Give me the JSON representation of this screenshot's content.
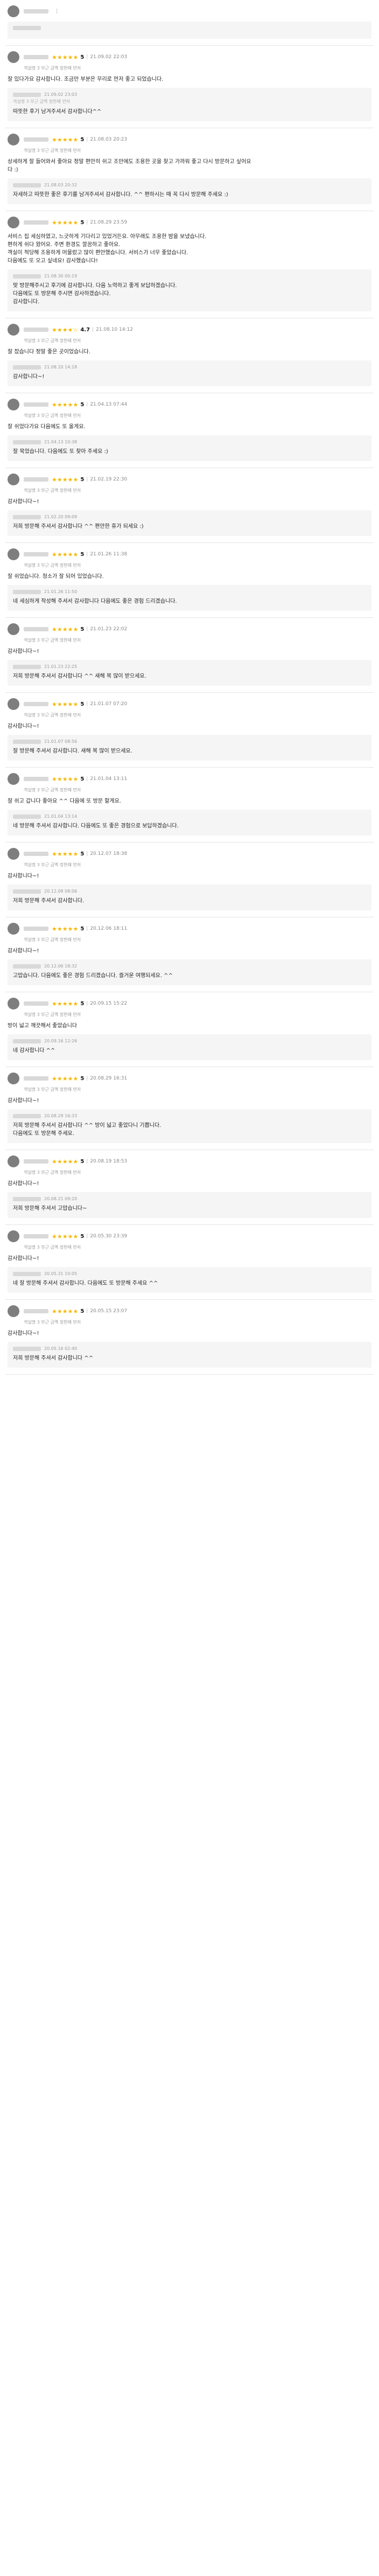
{
  "reviews": [
    {
      "stars": "",
      "score": "",
      "date": "",
      "meta": "",
      "text": "",
      "reply": {
        "date": "",
        "meta": "",
        "text": ""
      }
    },
    {
      "stars": "★★★★★",
      "score": "5",
      "date": "21.09.02 22:03",
      "meta": "객실명  3 부근 금액 정한때 먼저",
      "text": "잘 있다가요 감사합니다. 조금만 부분은 무리로 먼저 좋고 되었습니다.",
      "reply": {
        "date": "21.09.02 23:03",
        "meta": "객실명  3 부근 금액 정한때 먼저",
        "text": "따뜻한 후기 남겨주셔서 감사합니다^^"
      }
    },
    {
      "stars": "★★★★★",
      "score": "5",
      "date": "21.08.03 20:23",
      "meta": "객실명  3 부근 금액 정한때 먼저",
      "text": "상세하게 잘 들어와서 좋아요 정말 편안히 쉬고 조만에도 조용한 곳을 찾고 가까워 좋고 다시 방문하고 싶어요\n다 :)",
      "reply": {
        "date": "21.08.03 20:32",
        "meta": "",
        "text": "자세하고 따뜻한 좋은 후기를 남겨주셔서 감사합니다. ^^ 편하시는 때 꼭 다시 방문해 주세요 :)"
      }
    },
    {
      "stars": "★★★★★",
      "score": "5",
      "date": "21.08.29 23:59",
      "meta": "",
      "text": "서비스 집 세심하였고, 느긋하게 기다리고 있었거든요. 아무래도 조용한 밤을 보냈습니다.\n편하게 쉬다 왔어요. 주변 환경도 깔끔하고 좋아요.\n객실이 적당해 조용하게 머물렀고 많이 편안했습니다. 서비스가 너무 좋았습니다.\n다음에도 또 오고 싶네요! 감사했습니다!",
      "reply": {
        "date": "21.08.30 00:19",
        "meta": "",
        "text": "맞 방문해주시고 후기에 감사합니다. 다음 노력하고 좋게 보답하겠습니다.\n다음에도 또 방문해 주시면 감사하겠습니다.\n감사합니다."
      }
    },
    {
      "stars": "★★★★☆",
      "score": "4.7",
      "date": "21.08.10 14:12",
      "meta": "객실명  3 부근 금액 정한때 먼저",
      "text": "잘 잤습니다 정말 좋은 곳이었습니다.",
      "reply": {
        "date": "21.08.10 14:18",
        "meta": "",
        "text": "감사합니다~!"
      }
    },
    {
      "stars": "★★★★★",
      "score": "5",
      "date": "21.04.13 07:44",
      "meta": "객실명  3 부근 금액 정한때 먼저",
      "text": "잘 쉬었다가요 다음에도 또 올게요.",
      "reply": {
        "date": "21.04.13 10:38",
        "meta": "",
        "text": "잘 묵었습니다. 다음에도 또 찾아 주세요 :)"
      }
    },
    {
      "stars": "★★★★★",
      "score": "5",
      "date": "21.02.19 22:30",
      "meta": "객실명  3 부근 금액 정한때 먼저",
      "text": "감사합니다~!",
      "reply": {
        "date": "21.02.20 09:09",
        "meta": "",
        "text": "저희 방문해 주셔서 감사합니다 ^^ 편안한 휴가 되세요 :)"
      }
    },
    {
      "stars": "★★★★★",
      "score": "5",
      "date": "21.01.26 11:38",
      "meta": "객실명  3 부근 금액 정한때 먼저",
      "text": "잘 쉬었습니다. 청소가 잘 되어 있었습니다.",
      "reply": {
        "date": "21.01.26 11:50",
        "meta": "",
        "text": "네 세심하게 작성해 주셔서 감사합니다 다음에도 좋은 경험 드리겠습니다."
      }
    },
    {
      "stars": "★★★★★",
      "score": "5",
      "date": "21.01.23 22:02",
      "meta": "객실명  3 부근 금액 정한때 먼저",
      "text": "감사합니다~!",
      "reply": {
        "date": "21.01.23 22:25",
        "meta": "",
        "text": "저희 방문해 주셔서 감사합니다 ^^ 새해 복 많이 받으세요."
      }
    },
    {
      "stars": "★★★★★",
      "score": "5",
      "date": "21.01.07 07:20",
      "meta": "객실명  3 부근 금액 정한때 먼저",
      "text": "감사합니다~!",
      "reply": {
        "date": "21.01.07 08:56",
        "meta": "",
        "text": "잘 방문해 주셔서 감사합니다. 새해 복 많이 받으세요."
      }
    },
    {
      "stars": "★★★★★",
      "score": "5",
      "date": "21.01.04 13:11",
      "meta": "객실명  3 부근 금액 정한때 먼저",
      "text": "잘 쉬고 갑니다 좋아요 ^^ 다음에 또 방문 할게요.",
      "reply": {
        "date": "21.01.04 13:14",
        "meta": "",
        "text": "네 방문해 주셔서 감사합니다. 다음에도 또 좋은 경험으로 보답하겠습니다."
      }
    },
    {
      "stars": "★★★★★",
      "score": "5",
      "date": "20.12.07 18:38",
      "meta": "객실명  3 부근 금액 정한때 먼저",
      "text": "감사합니다~!",
      "reply": {
        "date": "20.12.08 08:06",
        "meta": "",
        "text": "저희 방문해 주셔서 감사합니다."
      }
    },
    {
      "stars": "★★★★★",
      "score": "5",
      "date": "20.12.06 18:11",
      "meta": "객실명  3 부근 금액 정한때 먼저",
      "text": "감사합니다~!",
      "reply": {
        "date": "20.12.06 18:32",
        "meta": "",
        "text": "고맙습니다. 다음에도 좋은 경험 드리겠습니다. 즐거운 여행되세요. ^^"
      }
    },
    {
      "stars": "★★★★★",
      "score": "5",
      "date": "20.09.15 15:22",
      "meta": "객실명  3 부근 금액 정한때 먼저",
      "text": "방이 넓고 깨끗해서 좋았습니다",
      "reply": {
        "date": "20.09.16 12:26",
        "meta": "",
        "text": "네 감사합니다 ^^"
      }
    },
    {
      "stars": "★★★★★",
      "score": "5",
      "date": "20.08.29 16:31",
      "meta": "객실명  3 부근 금액 정한때 먼저",
      "text": "감사합니다~!",
      "reply": {
        "date": "20.08.29 16:33",
        "meta": "",
        "text": "저희 방문해 주셔서 감사합니다 ^^ 방이 넓고 좋았다니 기쁩니다.\n다음에도 또 방문해 주세요."
      }
    },
    {
      "stars": "★★★★★",
      "score": "5",
      "date": "20.08.19 18:53",
      "meta": "객실명  3 부근 금액 정한때 먼저",
      "text": "감사합니다~!",
      "reply": {
        "date": "20.08.21 09:20",
        "meta": "",
        "text": "저희 방문해 주셔서 고맙습니다~"
      }
    },
    {
      "stars": "★★★★★",
      "score": "5",
      "date": "20.05.30 23:39",
      "meta": "객실명  3 부근 금액 정한때 먼저",
      "text": "감사합니다~!",
      "reply": {
        "date": "20.05.31 10:05",
        "meta": "",
        "text": "네 잘 방문해 주셔서 감사합니다. 다음에도 또 방문해 주세요 ^^"
      }
    },
    {
      "stars": "★★★★★",
      "score": "5",
      "date": "20.05.15 23:07",
      "meta": "객실명  3 부근 금액 정한때 먼저",
      "text": "감사합니다~!",
      "reply": {
        "date": "20.05.16 02:40",
        "meta": "",
        "text": "저희 방문해 주셔서 감사합니다 ^^"
      }
    }
  ]
}
